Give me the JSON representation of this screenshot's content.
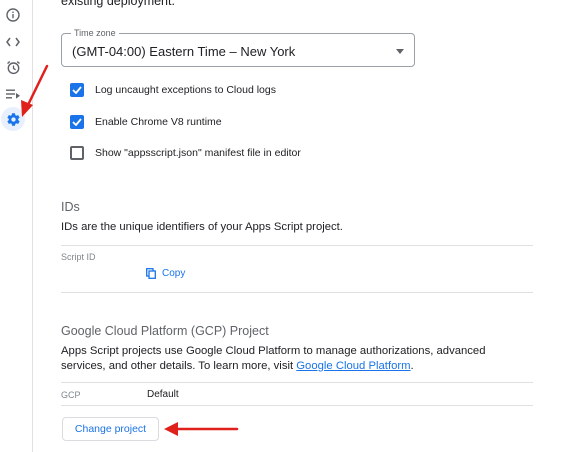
{
  "sidebar": {
    "items": [
      {
        "icon": "info-icon",
        "glyph": "ⓘ"
      },
      {
        "icon": "code-icon",
        "glyph": "<>"
      },
      {
        "icon": "alarm-icon",
        "glyph": "⏰"
      },
      {
        "icon": "executions-icon",
        "glyph": "≡▸"
      },
      {
        "icon": "gear-icon",
        "glyph": "⚙",
        "active": true
      }
    ]
  },
  "settings": {
    "partial_text": "existing deployment.",
    "timezone": {
      "label": "Time zone",
      "value": "(GMT-04:00) Eastern Time – New York"
    },
    "checkboxes": [
      {
        "label": "Log uncaught exceptions to Cloud logs",
        "checked": true
      },
      {
        "label": "Enable Chrome V8 runtime",
        "checked": true
      },
      {
        "label": "Show \"appsscript.json\" manifest file in editor",
        "checked": false
      }
    ]
  },
  "ids": {
    "title": "IDs",
    "description": "IDs are the unique identifiers of your Apps Script project.",
    "script_id_label": "Script ID",
    "copy_label": "Copy"
  },
  "gcp": {
    "title": "Google Cloud Platform (GCP) Project",
    "description": "Apps Script projects use Google Cloud Platform to manage authorizations, advanced services, and other details. To learn more, visit ",
    "link_text": "Google Cloud Platform",
    "description_end": ".",
    "gcp_label": "GCP",
    "gcp_value": "Default",
    "change_button": "Change project"
  },
  "colors": {
    "accent": "#1a73e8",
    "annotation_arrow": "#e0201b"
  }
}
